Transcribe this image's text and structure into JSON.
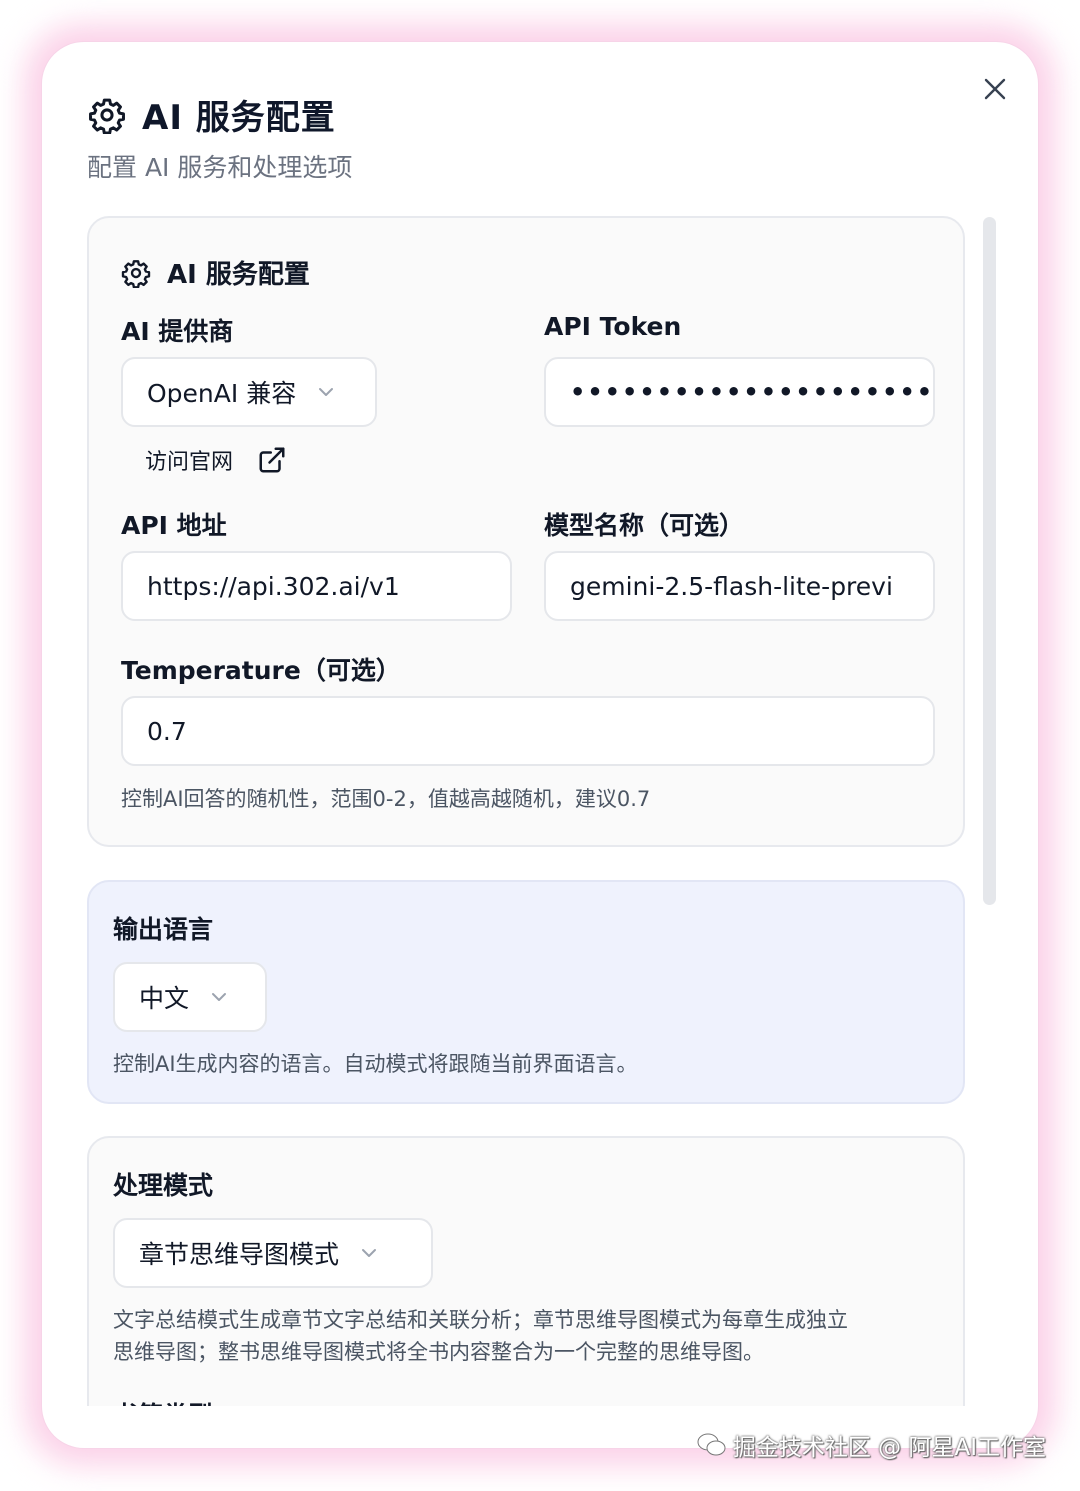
{
  "dialog": {
    "title": "AI 服务配置",
    "subtitle": "配置 AI 服务和处理选项",
    "icons": {
      "title": "gear-icon",
      "close": "close-icon"
    }
  },
  "ai_card": {
    "header": "AI 服务配置",
    "provider_label": "AI 提供商",
    "provider_value": "OpenAI 兼容",
    "visit_link": "访问官网",
    "token_label": "API Token",
    "token_value": "••••••••••••••••••••••••••",
    "address_label": "API 地址",
    "address_value": "https://api.302.ai/v1",
    "model_label": "模型名称（可选）",
    "model_value": "gemini-2.5-flash-lite-previ",
    "temperature_label": "Temperature（可选）",
    "temperature_value": "0.7",
    "temperature_help": "控制AI回答的随机性，范围0-2，值越高越随机，建议0.7"
  },
  "language_card": {
    "label": "输出语言",
    "value": "中文",
    "help": "控制AI生成内容的语言。自动模式将跟随当前界面语言。"
  },
  "mode_card": {
    "label": "处理模式",
    "value": "章节思维导图模式",
    "help_line1": "文字总结模式生成章节文字总结和关联分析；章节思维导图模式为每章生成独立",
    "help_line2": "思维导图；整书思维导图模式将全书内容整合为一个完整的思维导图。",
    "next_label": "书籍类型"
  },
  "watermark": "掘金技术社区 @ 阿星AI工作室",
  "colors": {
    "accent_glow": "#fbcde6",
    "language_card_bg": "#eff2fd",
    "card_bg": "#fafafa"
  }
}
